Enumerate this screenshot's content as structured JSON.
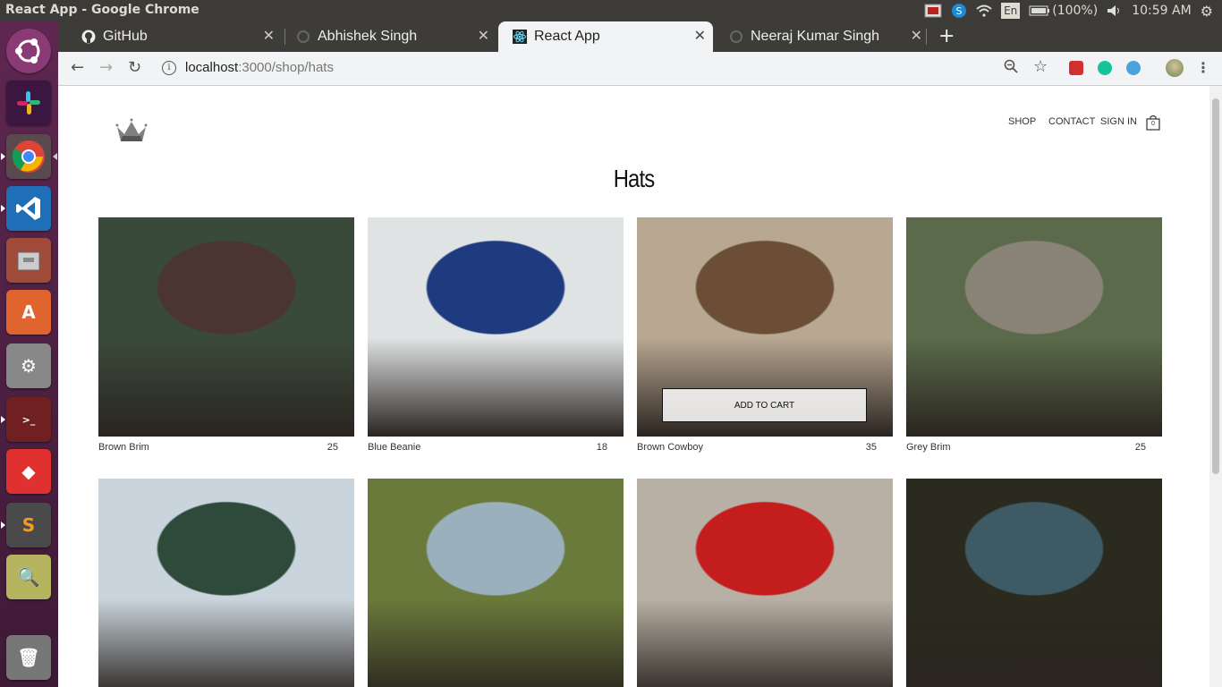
{
  "os": {
    "window_title": "React App - Google Chrome",
    "keyboard": "En",
    "battery": "(100%)",
    "clock": "10:59 AM"
  },
  "browser": {
    "tabs": [
      {
        "label": "GitHub",
        "icon": "github-icon"
      },
      {
        "label": "Abhishek Singh",
        "icon": "loading-icon"
      },
      {
        "label": "React App",
        "icon": "react-icon",
        "active": true
      },
      {
        "label": "Neeraj Kumar Singh",
        "icon": "loading-icon"
      }
    ],
    "url_host": "localhost",
    "url_path": ":3000/shop/hats"
  },
  "site": {
    "nav": {
      "shop": "SHOP",
      "contact": "CONTACT",
      "sign_in": "SIGN IN",
      "cart_count": "0"
    },
    "heading": "Hats",
    "add_to_cart": "ADD TO CART",
    "items": [
      {
        "name": "Brown Brim",
        "price": "25",
        "colors": [
          "#3a4a3a",
          "#4a3530"
        ]
      },
      {
        "name": "Blue Beanie",
        "price": "18",
        "colors": [
          "#dfe3e4",
          "#1e3b80"
        ]
      },
      {
        "name": "Brown Cowboy",
        "price": "35",
        "colors": [
          "#b8a892",
          "#6b4e35"
        ]
      },
      {
        "name": "Grey Brim",
        "price": "25",
        "colors": [
          "#5a6a4a",
          "#8a8478"
        ]
      },
      {
        "name": "",
        "price": "",
        "colors": [
          "#c9d4dc",
          "#2e4a3a"
        ]
      },
      {
        "name": "",
        "price": "",
        "colors": [
          "#6a7a3a",
          "#9ab0bc"
        ]
      },
      {
        "name": "",
        "price": "",
        "colors": [
          "#b8b0a4",
          "#c41d1d"
        ]
      },
      {
        "name": "",
        "price": "",
        "colors": [
          "#2a2a1e",
          "#3e5a64"
        ]
      }
    ]
  }
}
